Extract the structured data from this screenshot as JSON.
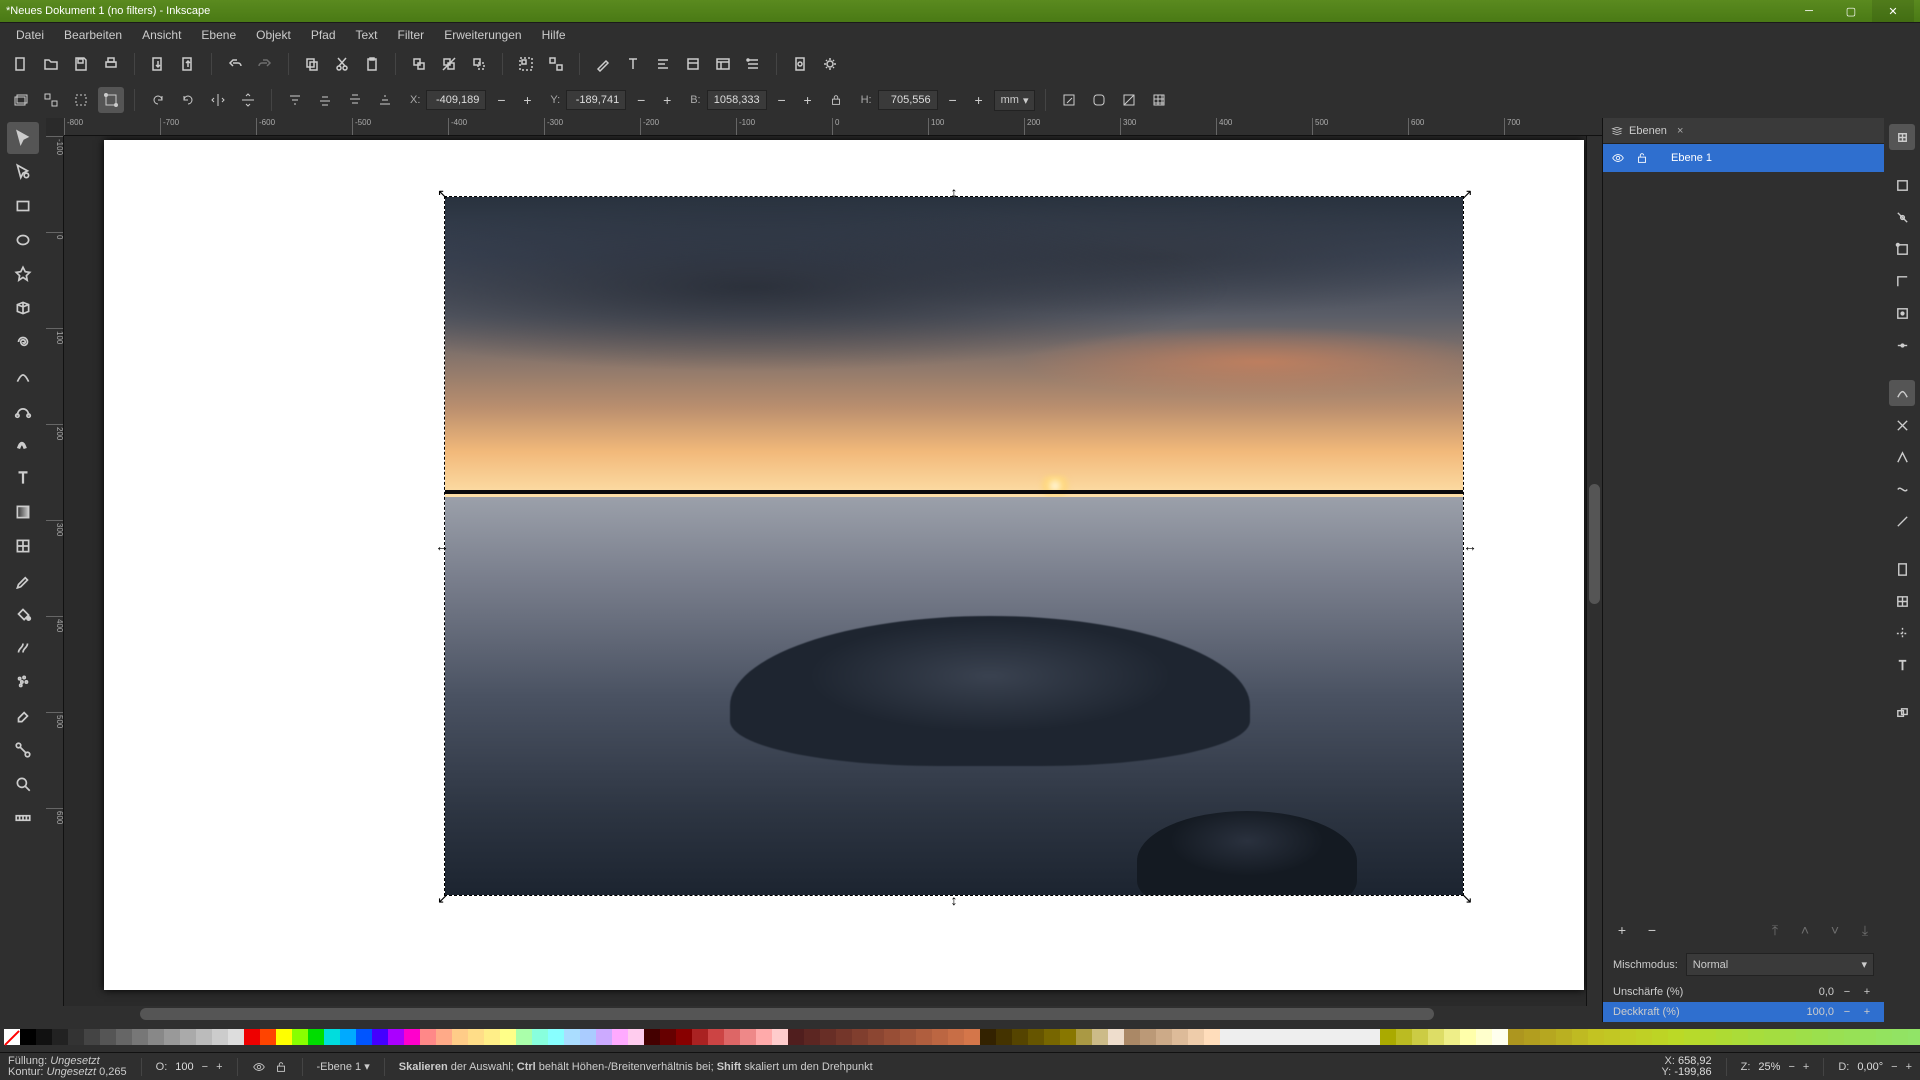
{
  "title": "*Neues Dokument 1 (no filters) - Inkscape",
  "menu": [
    "Datei",
    "Bearbeiten",
    "Ansicht",
    "Ebene",
    "Objekt",
    "Pfad",
    "Text",
    "Filter",
    "Erweiterungen",
    "Hilfe"
  ],
  "opt": {
    "x_label": "X:",
    "x": "-409,189",
    "y_label": "Y:",
    "y": "-189,741",
    "w_label": "B:",
    "w": "1058,333",
    "h_label": "H:",
    "h": "705,556",
    "unit": "mm"
  },
  "ruler_h": [
    "-800",
    "-700",
    "-600",
    "-500",
    "-400",
    "-300",
    "-200",
    "-100",
    "0",
    "100",
    "200",
    "300",
    "400",
    "500",
    "600",
    "700"
  ],
  "ruler_v": [
    "-100",
    "0",
    "100",
    "200",
    "300",
    "400",
    "500",
    "600"
  ],
  "panel": {
    "tab": "Ebenen",
    "layer": "Ebene 1",
    "blend_label": "Mischmodus:",
    "blend": "Normal",
    "blur_label": "Unschärfe (%)",
    "blur": "0,0",
    "opacity_label": "Deckkraft (%)",
    "opacity": "100,0"
  },
  "status": {
    "fill_label": "Füllung:",
    "fill": "Ungesetzt",
    "stroke_label": "Kontur:",
    "stroke": "Ungesetzt",
    "stroke_w": "0,265",
    "o_label": "O:",
    "o": "100",
    "layer_sel": "-Ebene 1",
    "hint1": "Skalieren",
    "hint2": " der Auswahl; ",
    "hint3": "Ctrl",
    "hint4": " behält Höhen-/Breitenverhältnis bei; ",
    "hint5": "Shift",
    "hint6": " skaliert um den Drehpunkt",
    "x_label": "X:",
    "x": "658,92",
    "y_label": "Y:",
    "y": "-199,86",
    "z_label": "Z:",
    "z": "25%",
    "d_label": "D:",
    "d": "0,00°"
  },
  "swatches_gray": [
    "#000",
    "#111",
    "#222",
    "#333",
    "#444",
    "#555",
    "#666",
    "#777",
    "#888",
    "#999",
    "#aaa",
    "#bbb",
    "#ccc",
    "#ddd"
  ],
  "swatches_hue": [
    "#e00",
    "#f40",
    "#ff0",
    "#8f0",
    "#0d0",
    "#0dd",
    "#0af",
    "#05f",
    "#40f",
    "#a0f",
    "#f0c"
  ],
  "swatches_pastel": [
    "#f88",
    "#fa8",
    "#fc8",
    "#fd8",
    "#fe8",
    "#ff8",
    "#afa",
    "#8fd",
    "#8ff",
    "#adf",
    "#acf",
    "#caf",
    "#faf",
    "#fce"
  ],
  "swatches_red": [
    "#400",
    "#600",
    "#800",
    "#a22",
    "#c44",
    "#d66",
    "#e88",
    "#faa",
    "#fcc"
  ],
  "swatches_brown": [
    "#320",
    "#430",
    "#540",
    "#650",
    "#760",
    "#870",
    "#a94",
    "#cb8",
    "#edc"
  ],
  "swatches_tan": [
    "#a86",
    "#b97",
    "#ca8",
    "#db9",
    "#eca",
    "#fdb"
  ],
  "swatches_yellow": [
    "#aa0",
    "#bb2",
    "#cc4",
    "#dd6",
    "#ee8",
    "#ffa",
    "#ffc",
    "#ffe"
  ]
}
